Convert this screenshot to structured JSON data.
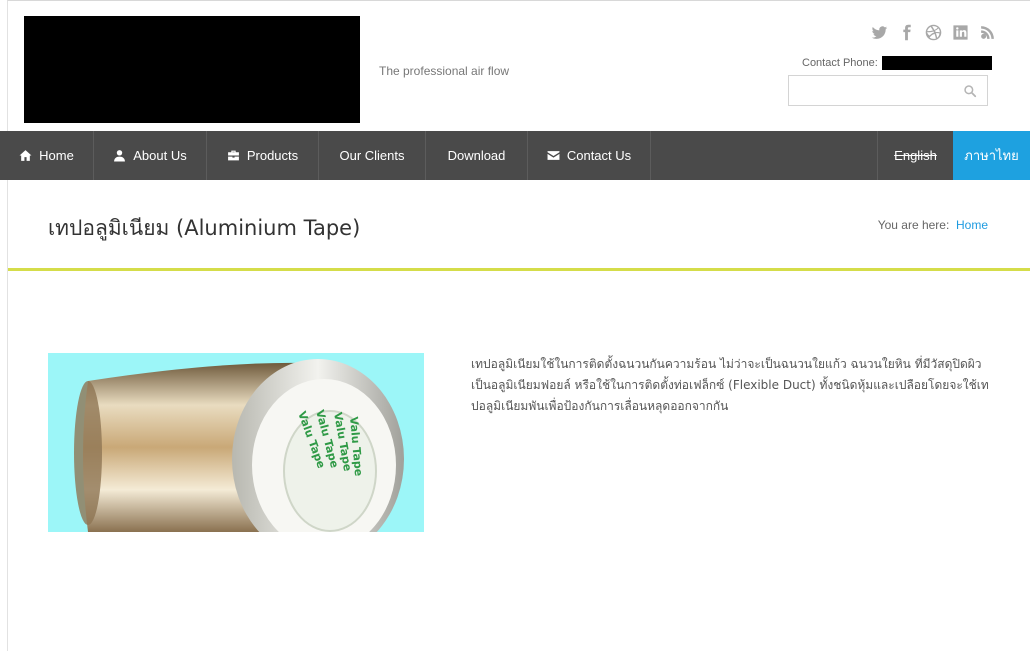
{
  "header": {
    "tagline": "The professional air flow",
    "contact_label": "Contact Phone:",
    "search_placeholder": "",
    "social_icons": [
      "twitter-icon",
      "facebook-icon",
      "dribbble-icon",
      "linkedin-icon",
      "rss-icon"
    ]
  },
  "nav": {
    "items": [
      {
        "label": "Home",
        "icon": "home-icon"
      },
      {
        "label": "About Us",
        "icon": "user-icon"
      },
      {
        "label": "Products",
        "icon": "briefcase-icon"
      },
      {
        "label": "Our Clients",
        "icon": ""
      },
      {
        "label": "Download",
        "icon": ""
      },
      {
        "label": "Contact Us",
        "icon": "envelope-icon"
      }
    ],
    "lang_english": "English",
    "lang_thai": "ภาษาไทย"
  },
  "page": {
    "title": "เทปอลูมิเนียม (Aluminium Tape)",
    "breadcrumb_prefix": "You are here:",
    "breadcrumb_home": "Home",
    "description": "เทปอลูมิเนียมใช้ในการติดตั้งฉนวนกันความร้อน ไม่ว่าจะเป็นฉนวนใยแก้ว ฉนวนใยหิน ที่มีวัสดุปิดผิวเป็นอลูมิเนียมฟอยล์ หรือใช้ในการติดตั้งท่อเฟล็กซ์ (Flexible Duct) ทั้งชนิดหุ้มและเปลือยโดยจะใช้เทปอลูมิเนียมพันเพื่อป้องกันการเลื่อนหลุดออกจากกัน",
    "image_text": "Valu Tape"
  },
  "colors": {
    "nav_bg": "#4a4a4a",
    "accent_blue": "#1ea1e0",
    "title_underline": "#d5dd4a",
    "image_bg": "#9cf6f8"
  }
}
